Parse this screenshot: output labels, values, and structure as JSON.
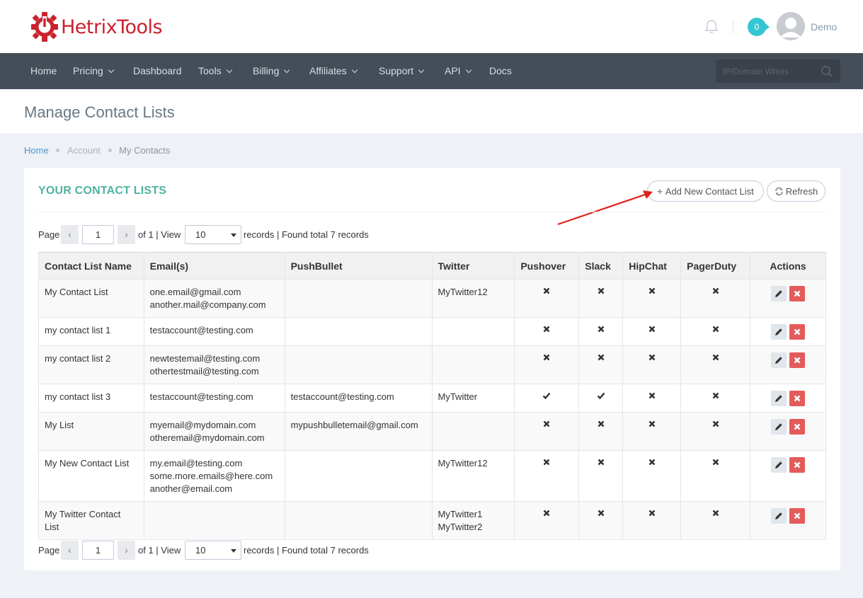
{
  "brand": {
    "name": "HetrixTools"
  },
  "header": {
    "notification_count": "0",
    "user_name": "Demo"
  },
  "nav": {
    "items": [
      {
        "label": "Home",
        "dropdown": false
      },
      {
        "label": "Pricing",
        "dropdown": true
      },
      {
        "label": "Dashboard",
        "dropdown": false
      },
      {
        "label": "Tools",
        "dropdown": true
      },
      {
        "label": "Billing",
        "dropdown": true
      },
      {
        "label": "Affiliates",
        "dropdown": true
      },
      {
        "label": "Support",
        "dropdown": true
      },
      {
        "label": "API",
        "dropdown": true
      },
      {
        "label": "Docs",
        "dropdown": false
      }
    ],
    "search_placeholder": "IP/Domain Whois"
  },
  "page": {
    "title": "Manage Contact Lists"
  },
  "breadcrumb": {
    "home": "Home",
    "account": "Account",
    "current": "My Contacts"
  },
  "portlet": {
    "title": "YOUR CONTACT LISTS",
    "add_button": "Add New Contact List",
    "refresh_button": "Refresh"
  },
  "pager": {
    "page_label": "Page",
    "page_value": "1",
    "of_text": "of 1 | View",
    "per_page": "10",
    "records_text": "records | Found total 7 records"
  },
  "table": {
    "headers": [
      "Contact List Name",
      "Email(s)",
      "PushBullet",
      "Twitter",
      "Pushover",
      "Slack",
      "HipChat",
      "PagerDuty",
      "Actions"
    ],
    "rows": [
      {
        "name": "My Contact List",
        "emails": "one.email@gmail.com\nanother.mail@company.com",
        "pushbullet": "",
        "twitter": "MyTwitter12",
        "pushover": false,
        "slack": false,
        "hipchat": false,
        "pagerduty": false
      },
      {
        "name": "my contact list 1",
        "emails": "testaccount@testing.com",
        "pushbullet": "",
        "twitter": "",
        "pushover": false,
        "slack": false,
        "hipchat": false,
        "pagerduty": false
      },
      {
        "name": "my contact list 2",
        "emails": "newtestemail@testing.com\nothertestmail@testing.com",
        "pushbullet": "",
        "twitter": "",
        "pushover": false,
        "slack": false,
        "hipchat": false,
        "pagerduty": false
      },
      {
        "name": "my contact list 3",
        "emails": "testaccount@testing.com",
        "pushbullet": "testaccount@testing.com",
        "twitter": "MyTwitter",
        "pushover": true,
        "slack": true,
        "hipchat": false,
        "pagerduty": false
      },
      {
        "name": "My List",
        "emails": "myemail@mydomain.com\notheremail@mydomain.com",
        "pushbullet": "mypushbulletemail@gmail.com",
        "twitter": "",
        "pushover": false,
        "slack": false,
        "hipchat": false,
        "pagerduty": false
      },
      {
        "name": "My New Contact List",
        "emails": "my.email@testing.com\nsome.more.emails@here.com\nanother@email.com",
        "pushbullet": "",
        "twitter": "MyTwitter12",
        "pushover": false,
        "slack": false,
        "hipchat": false,
        "pagerduty": false
      },
      {
        "name": "My Twitter Contact\nList",
        "emails": "",
        "pushbullet": "",
        "twitter": "MyTwitter1\nMyTwitter2",
        "pushover": false,
        "slack": false,
        "hipchat": false,
        "pagerduty": false
      }
    ]
  },
  "colors": {
    "brand_red": "#c9232e",
    "accent_teal": "#4db3a2",
    "nav_bg": "#444d58",
    "delete_red": "#e35b5a",
    "badge": "#36c6d3",
    "annotation_arrow": "#e0201b"
  }
}
